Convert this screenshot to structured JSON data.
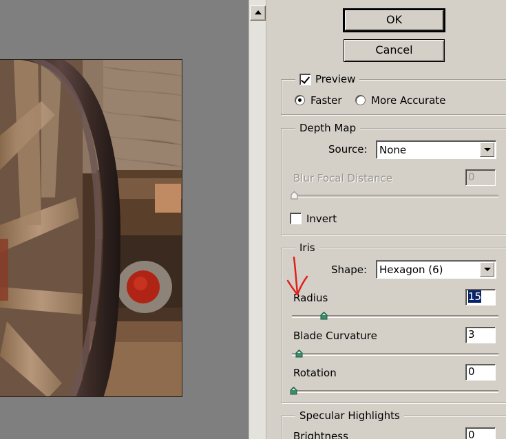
{
  "buttons": {
    "ok": "OK",
    "cancel": "Cancel"
  },
  "preview": {
    "checkbox_label": "Preview",
    "checked": true,
    "radio_faster": "Faster",
    "radio_accurate": "More Accurate",
    "selected": "Faster"
  },
  "depth_map": {
    "title": "Depth Map",
    "source_label": "Source:",
    "source_value": "None",
    "blur_focal_label": "Blur Focal Distance",
    "blur_focal_value": "0",
    "invert_label": "Invert",
    "invert_checked": false
  },
  "iris": {
    "title": "Iris",
    "shape_label": "Shape:",
    "shape_value": "Hexagon (6)",
    "radius_label": "Radius",
    "radius_value": "15",
    "blade_curvature_label": "Blade Curvature",
    "blade_curvature_value": "3",
    "rotation_label": "Rotation",
    "rotation_value": "0"
  },
  "specular": {
    "title": "Specular Highlights",
    "brightness_label": "Brightness",
    "brightness_value": "0"
  },
  "colors": {
    "dialog_bg": "#d4d0c8",
    "preview_bg": "#7f7f7f",
    "annotation": "#e0201a",
    "selection": "#0a246a",
    "slider_thumb": "#3a8f6a"
  },
  "icons": [
    "scroll-up-arrow-icon",
    "dropdown-arrow-icon",
    "slider-thumb-icon",
    "red-annotation-arrow-icon"
  ]
}
